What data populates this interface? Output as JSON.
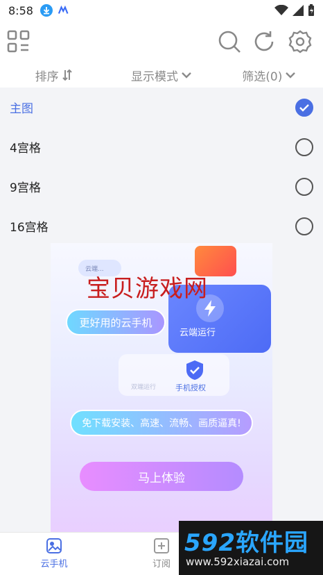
{
  "status_bar": {
    "time": "8:58"
  },
  "filters": [
    {
      "label": "排序"
    },
    {
      "label": "显示模式"
    },
    {
      "label": "筛选(0)"
    }
  ],
  "view_options": [
    {
      "label": "主图",
      "selected": true
    },
    {
      "label": "4宫格",
      "selected": false
    },
    {
      "label": "9宫格",
      "selected": false
    },
    {
      "label": "16宫格",
      "selected": false
    }
  ],
  "ad": {
    "watermark": "宝贝游戏网",
    "tagline": "更好用的云手机",
    "cloud_label": "云端运行",
    "auth_label": "手机授权",
    "faded_label": "双端运行",
    "badge": "云端...",
    "features": "免下载安装、高速、流畅、画质逼真!",
    "cta": "马上体验"
  },
  "bottom_nav": [
    {
      "label": "云手机",
      "active": true
    },
    {
      "label": "订阅",
      "active": false
    }
  ],
  "watermark_logo": {
    "digits": "592",
    "name": "软件园",
    "url": "www.592xiazai.com"
  },
  "colors": {
    "accent": "#4a6fe3"
  }
}
